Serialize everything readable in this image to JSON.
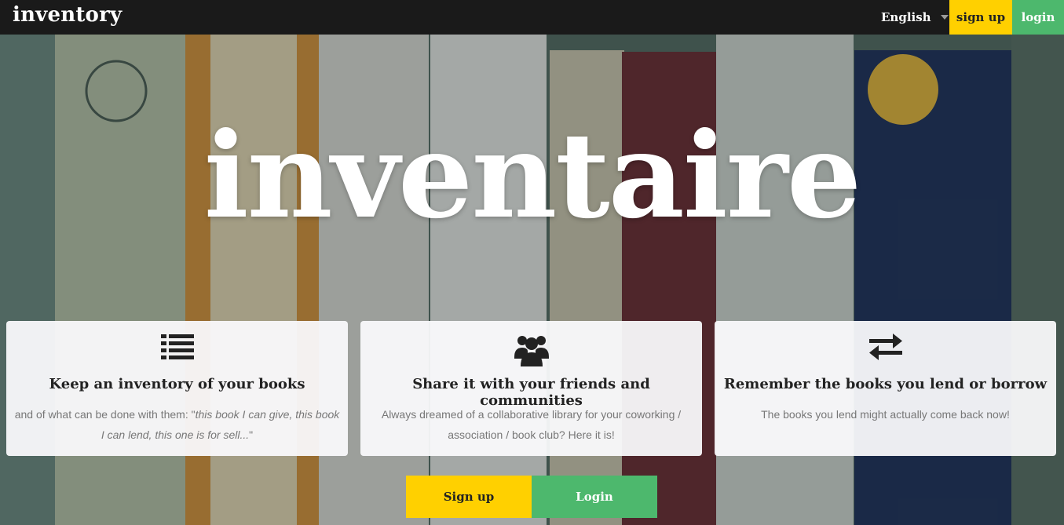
{
  "nav": {
    "brand": "inventory",
    "language": "English",
    "signup": "sign up",
    "login": "login"
  },
  "hero": {
    "title": "inventaire"
  },
  "features": [
    {
      "icon": "list-icon",
      "title": "Keep an inventory of your books",
      "text_prefix": "and of what can be done with them: \"",
      "text_italic": "this book I can give, this book I can lend, this one is for sell...",
      "text_suffix": "\""
    },
    {
      "icon": "users-icon",
      "title": "Share it with your friends and communities",
      "text": "Always dreamed of a collaborative library for your coworking / association / book club? Here it is!"
    },
    {
      "icon": "exchange-icon",
      "title": "Remember the books you lend or borrow",
      "text": "The books you lend might actually come back now!"
    }
  ],
  "cta": {
    "signup": "Sign up",
    "login": "Login"
  },
  "colors": {
    "topbar": "#1a1a1a",
    "yellow": "#ffd000",
    "green": "#4db86d"
  }
}
